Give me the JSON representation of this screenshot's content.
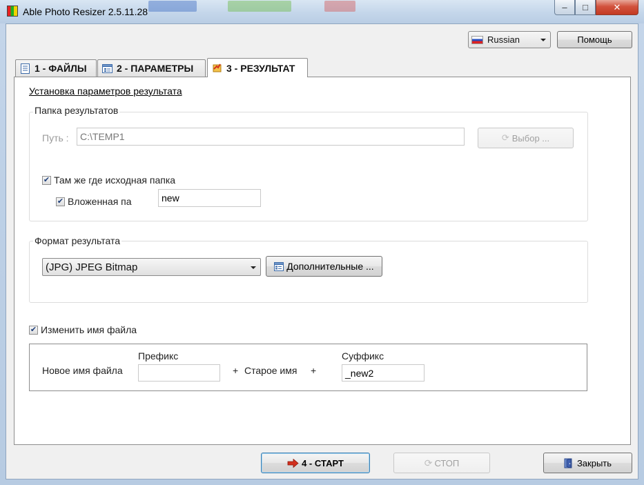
{
  "window": {
    "title": "Able Photo Resizer 2.5.11.28",
    "controls": {
      "minimize": "–",
      "maximize": "□",
      "close": "✕"
    }
  },
  "header": {
    "language": "Russian",
    "help_label": "Помощь"
  },
  "tabs": [
    {
      "label": "1 - ФАЙЛЫ",
      "icon": "file-list-icon",
      "active": false
    },
    {
      "label": "2 - ПАРАМЕТРЫ",
      "icon": "settings-form-icon",
      "active": false
    },
    {
      "label": "3 - РЕЗУЛЬТАТ",
      "icon": "result-output-icon",
      "active": true
    }
  ],
  "result": {
    "section_title": "Установка параметров результата",
    "output_folder": {
      "group_label": "Папка результатов",
      "path_label": "Путь :",
      "path_value": "C:\\TEMP1",
      "browse_label": "Выбор ...",
      "same_as_source_label": "Там же где исходная папка",
      "same_as_source_checked": true,
      "subfolder_label": "Вложенная па",
      "subfolder_checked": true,
      "subfolder_value": "new"
    },
    "output_format": {
      "group_label": "Формат результата",
      "selected": "(JPG) JPEG Bitmap",
      "advanced_label": "Дополнительные ..."
    },
    "rename": {
      "checkbox_label": "Изменить имя файла",
      "checked": true,
      "new_name_label": "Новое имя файла",
      "prefix_label": "Префикс",
      "prefix_value": "",
      "plus_1": "+",
      "old_name_label": "Старое имя",
      "plus_2": "+",
      "suffix_label": "Суффикс",
      "suffix_value": "_new2"
    }
  },
  "footer": {
    "start_label": "4 - СТАРТ",
    "stop_label": "СТОП",
    "close_label": "Закрыть"
  },
  "colors": {
    "accent_red": "#d2301e",
    "close_button": "#c33a23",
    "focus_border": "#3c7fb1"
  }
}
